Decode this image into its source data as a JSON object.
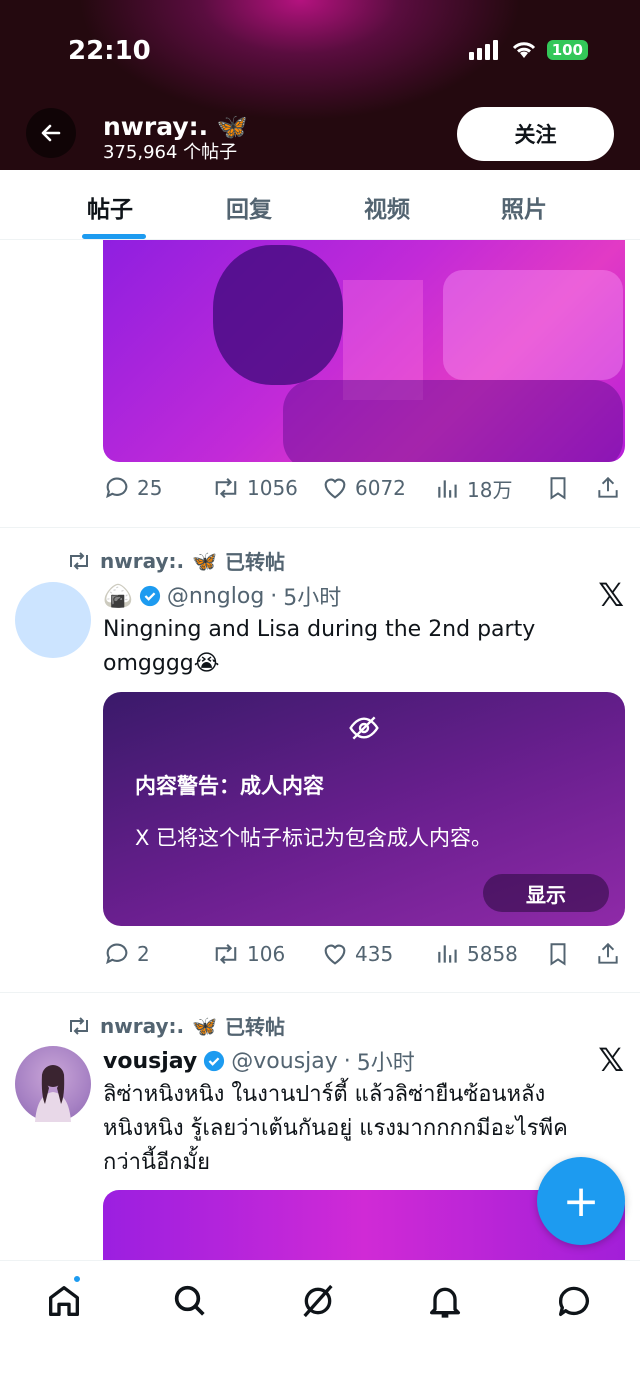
{
  "status_bar": {
    "time": "22:10",
    "battery": "100"
  },
  "header": {
    "name": "nwray:.",
    "post_count": "375,964 个帖子",
    "follow_label": "关注"
  },
  "tabs": [
    {
      "label": "帖子",
      "active": true
    },
    {
      "label": "回复"
    },
    {
      "label": "视频"
    },
    {
      "label": "照片"
    }
  ],
  "tweet1": {
    "replies": "25",
    "reposts": "1056",
    "likes": "6072",
    "views": "18万"
  },
  "tweet2": {
    "reposted_by": "nwray:.",
    "repost_label": "已转帖",
    "handle": "@nnglog",
    "time": "5小时",
    "text": "Ningning and Lisa during the 2nd party omgggg😭",
    "warning_title": "内容警告：成人内容",
    "warning_body": "X 已将这个帖子标记为包含成人内容。",
    "show_label": "显示",
    "replies": "2",
    "reposts": "106",
    "likes": "435",
    "views": "5858"
  },
  "tweet3": {
    "reposted_by": "nwray:.",
    "repost_label": "已转帖",
    "name": "vousjay",
    "handle": "@vousjay",
    "time": "5小时",
    "text": "ลิซ่าหนิงหนิง ในงานปาร์ตี้ แล้วลิซ่ายืนซ้อนหลังหนิงหนิง รู้เลยว่าเต้นกันอยู่ แรงมากกกกมีอะไรพีคกว่านี้อีกมั้ย"
  },
  "fab_label": "+",
  "colors": {
    "accent": "#1d9bf0",
    "muted": "#536471",
    "verified": "#1d9bf0"
  }
}
